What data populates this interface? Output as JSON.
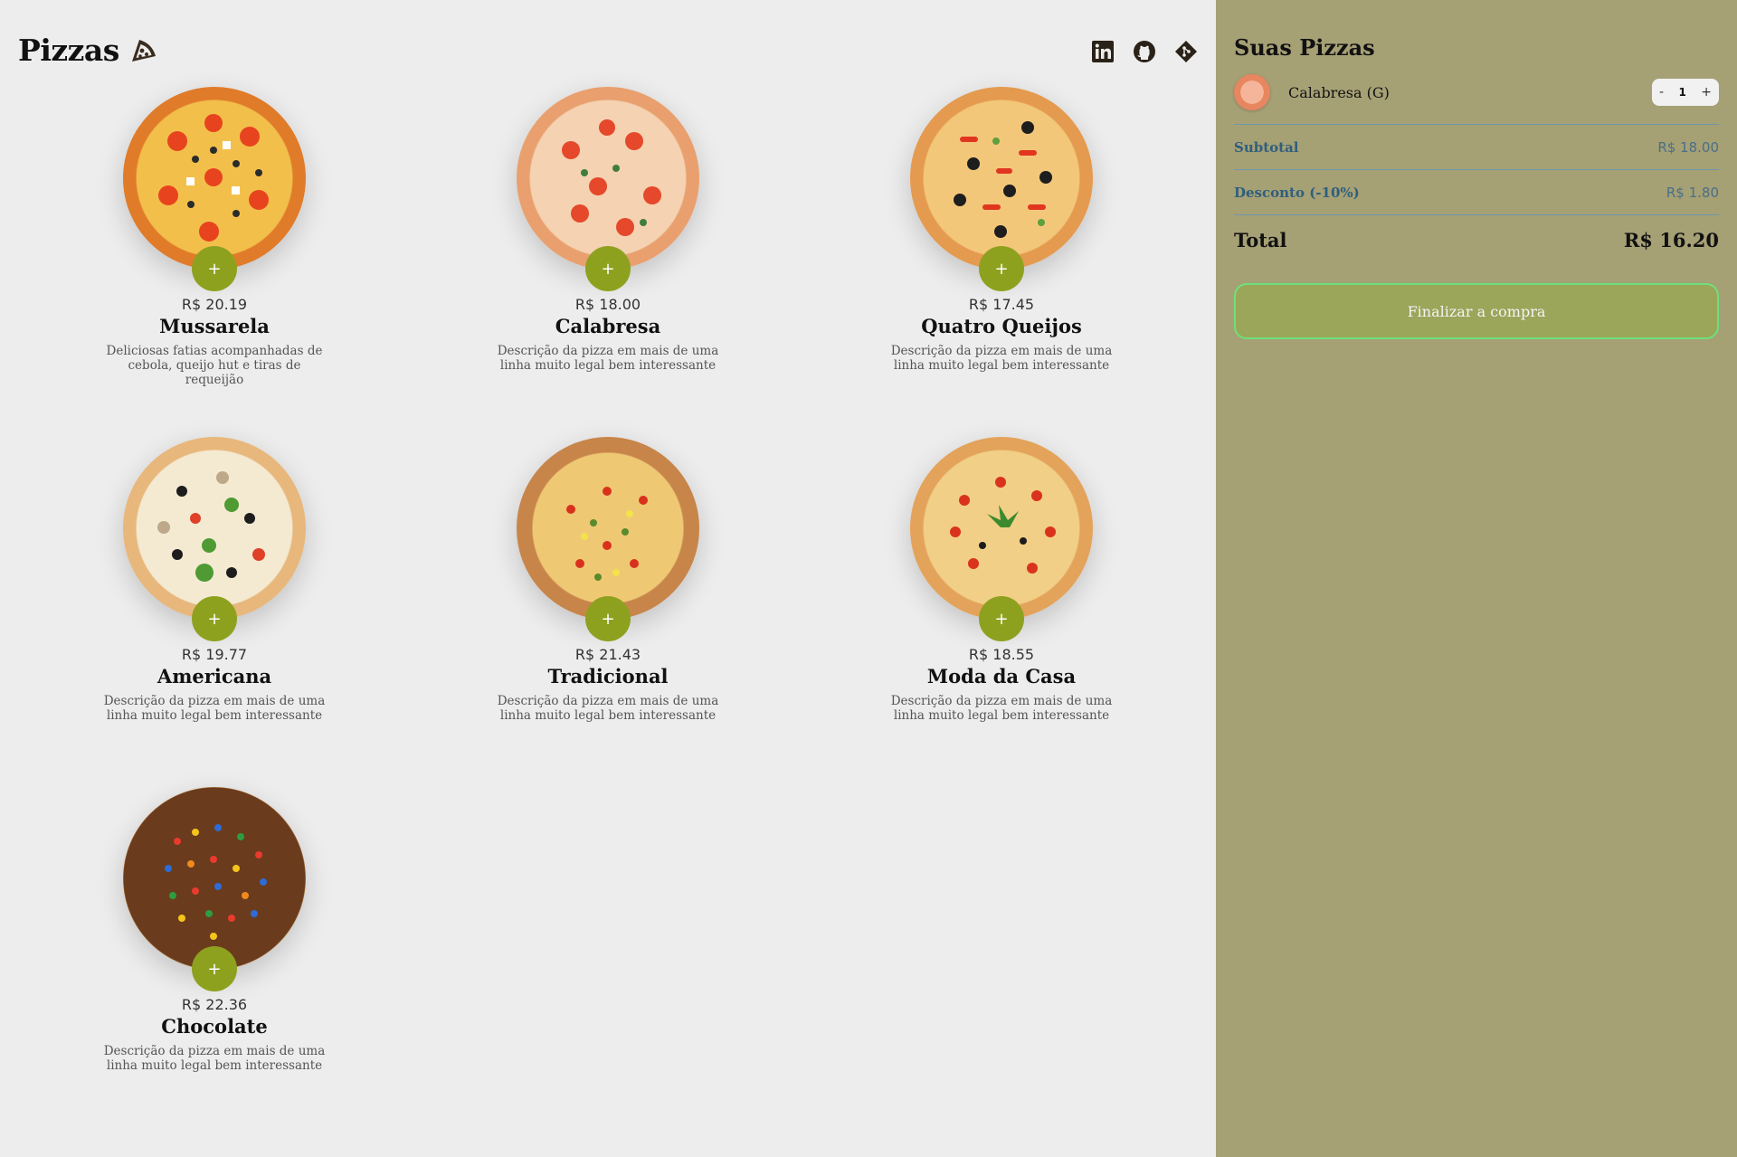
{
  "header": {
    "title": "Pizzas"
  },
  "social": {
    "links": [
      "linkedin-icon",
      "github-icon",
      "git-icon"
    ]
  },
  "pizzas": [
    {
      "name": "Mussarela",
      "price": "R$ 20.19",
      "description": "Deliciosas fatias acompanhadas de cebola, queijo hut e tiras de requeijão",
      "add_label": "+"
    },
    {
      "name": "Calabresa",
      "price": "R$ 18.00",
      "description": "Descrição da pizza em mais de uma linha muito legal bem interessante",
      "add_label": "+"
    },
    {
      "name": "Quatro Queijos",
      "price": "R$ 17.45",
      "description": "Descrição da pizza em mais de uma linha muito legal bem interessante",
      "add_label": "+"
    },
    {
      "name": "Americana",
      "price": "R$ 19.77",
      "description": "Descrição da pizza em mais de uma linha muito legal bem interessante",
      "add_label": "+"
    },
    {
      "name": "Tradicional",
      "price": "R$ 21.43",
      "description": "Descrição da pizza em mais de uma linha muito legal bem interessante",
      "add_label": "+"
    },
    {
      "name": "Moda da Casa",
      "price": "R$ 18.55",
      "description": "Descrição da pizza em mais de uma linha muito legal bem interessante",
      "add_label": "+"
    },
    {
      "name": "Chocolate",
      "price": "R$ 22.36",
      "description": "Descrição da pizza em mais de uma linha muito legal bem interessante",
      "add_label": "+"
    }
  ],
  "cart": {
    "title": "Suas Pizzas",
    "items": [
      {
        "name": "Calabresa (G)",
        "quantity": "1",
        "minus": "-",
        "plus": "+"
      }
    ],
    "subtotal_label": "Subtotal",
    "subtotal_value": "R$ 18.00",
    "discount_label": "Desconto (-10%)",
    "discount_value": "R$ 1.80",
    "total_label": "Total",
    "total_value": "R$ 16.20",
    "checkout_label": "Finalizar a compra"
  },
  "colors": {
    "background": "#ededed",
    "aside": "#a6a075",
    "accent": "#8ea11f",
    "checkout": "#9ba65a",
    "checkout_border": "#6ee07a",
    "summary_label": "#2f5f7d"
  }
}
